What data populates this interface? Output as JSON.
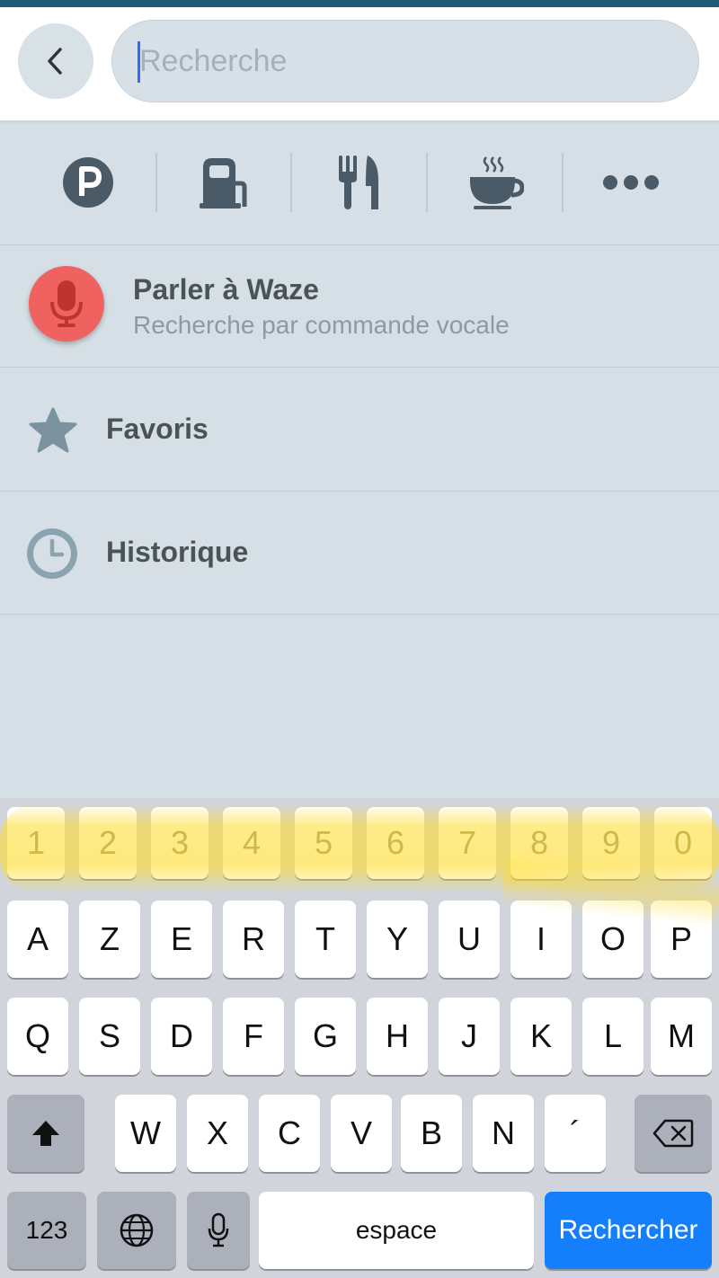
{
  "search": {
    "placeholder": "Recherche"
  },
  "categories": [
    "parking-icon",
    "gas-station-icon",
    "restaurant-icon",
    "coffee-icon",
    "more-icon"
  ],
  "voice": {
    "title": "Parler à Waze",
    "subtitle": "Recherche par commande vocale"
  },
  "favorites": {
    "label": "Favoris"
  },
  "history": {
    "label": "Historique"
  },
  "keyboard": {
    "numbers": [
      "1",
      "2",
      "3",
      "4",
      "5",
      "6",
      "7",
      "8",
      "9",
      "0"
    ],
    "row1": [
      "A",
      "Z",
      "E",
      "R",
      "T",
      "Y",
      "U",
      "I",
      "O",
      "P"
    ],
    "row2": [
      "Q",
      "S",
      "D",
      "F",
      "G",
      "H",
      "J",
      "K",
      "L",
      "M"
    ],
    "row3": [
      "W",
      "X",
      "C",
      "V",
      "B",
      "N",
      "´"
    ],
    "mode_label": "123",
    "space_label": "espace",
    "return_label": "Rechercher"
  },
  "colors": {
    "accent": "#147efb",
    "mic": "#f0625f",
    "icon": "#4a5a66",
    "highlight": "#ffdc28"
  }
}
